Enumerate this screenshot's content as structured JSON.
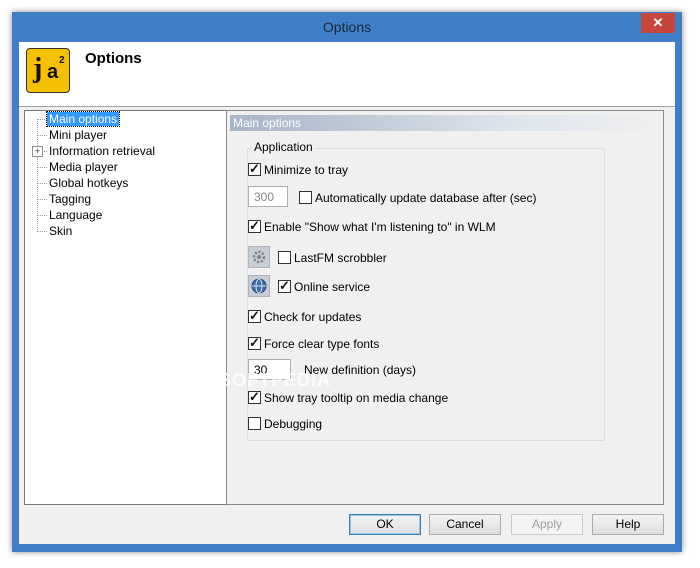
{
  "window": {
    "title": "Options",
    "close_glyph": "✕"
  },
  "header": {
    "title": "Options",
    "logo_j": "j",
    "logo_a": "a",
    "logo_sup": "2"
  },
  "tree": {
    "items": [
      {
        "label": "Main options",
        "selected": true
      },
      {
        "label": "Mini player"
      },
      {
        "label": "Information retrieval",
        "expander": "+"
      },
      {
        "label": "Media player"
      },
      {
        "label": "Global hotkeys"
      },
      {
        "label": "Tagging"
      },
      {
        "label": "Language"
      },
      {
        "label": "Skin"
      }
    ]
  },
  "panel": {
    "header": "Main options",
    "group_label": "Application",
    "minimize_to_tray": {
      "label": "Minimize to tray",
      "checked": true
    },
    "update_interval_value": "300",
    "auto_update": {
      "label": "Automatically update database after (sec)",
      "checked": false
    },
    "show_listening": {
      "label": "Enable \"Show what I'm listening to\" in WLM",
      "checked": true
    },
    "lastfm": {
      "label": "LastFM scrobbler",
      "checked": false,
      "icon": "gear-icon"
    },
    "online_service": {
      "label": "Online service",
      "checked": true,
      "icon": "globe-icon"
    },
    "check_updates": {
      "label": "Check for updates",
      "checked": true
    },
    "clear_type": {
      "label": "Force clear type fonts",
      "checked": true
    },
    "new_definition_value": "30",
    "new_definition_label": "New definition (days)",
    "tray_tooltip": {
      "label": "Show tray tooltip on media change",
      "checked": true
    },
    "debugging": {
      "label": "Debugging",
      "checked": false
    }
  },
  "buttons": {
    "ok": "OK",
    "cancel": "Cancel",
    "apply": "Apply",
    "help": "Help"
  },
  "watermark": "SOFTPEDIA"
}
